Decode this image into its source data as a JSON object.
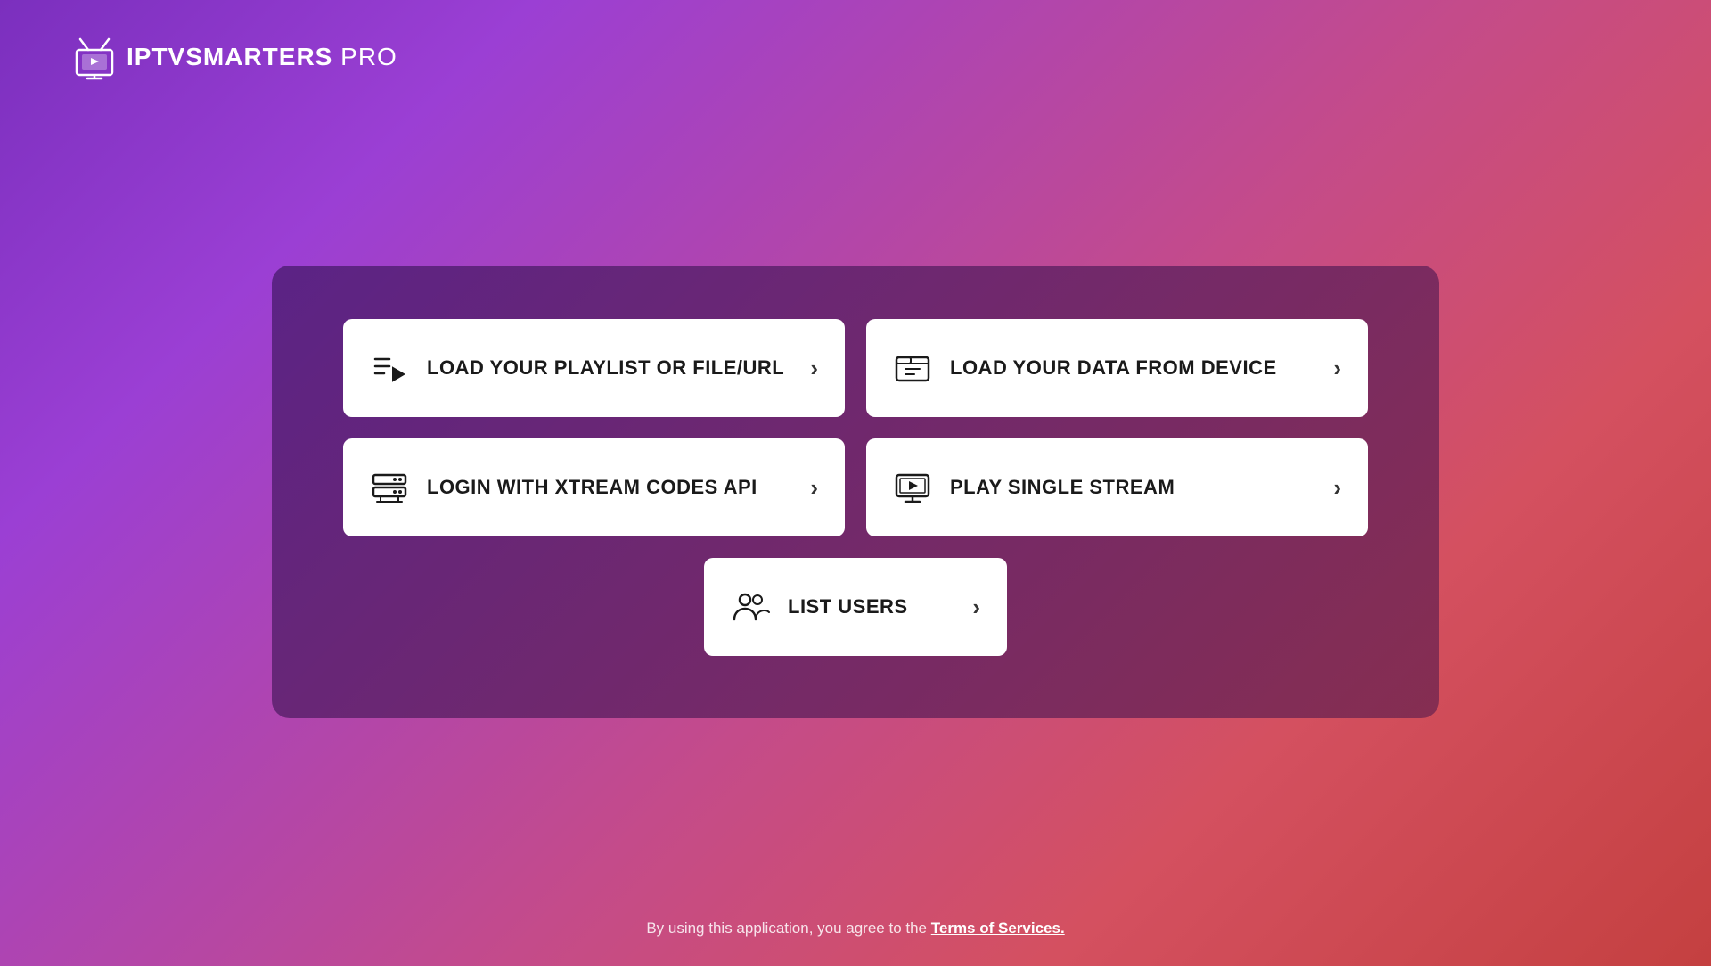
{
  "logo": {
    "brand_bold": "IPTV",
    "brand_name": "SMARTERS",
    "brand_suffix": " PRO"
  },
  "buttons": {
    "playlist": {
      "label": "LOAD YOUR PLAYLIST OR FILE/URL"
    },
    "device": {
      "label": "LOAD YOUR DATA FROM DEVICE"
    },
    "xtream": {
      "label": "LOGIN WITH XTREAM CODES API"
    },
    "single_stream": {
      "label": "PLAY SINGLE STREAM"
    },
    "list_users": {
      "label": "LIST USERS"
    }
  },
  "footer": {
    "text": "By using this application, you agree to the ",
    "link": "Terms of Services."
  }
}
